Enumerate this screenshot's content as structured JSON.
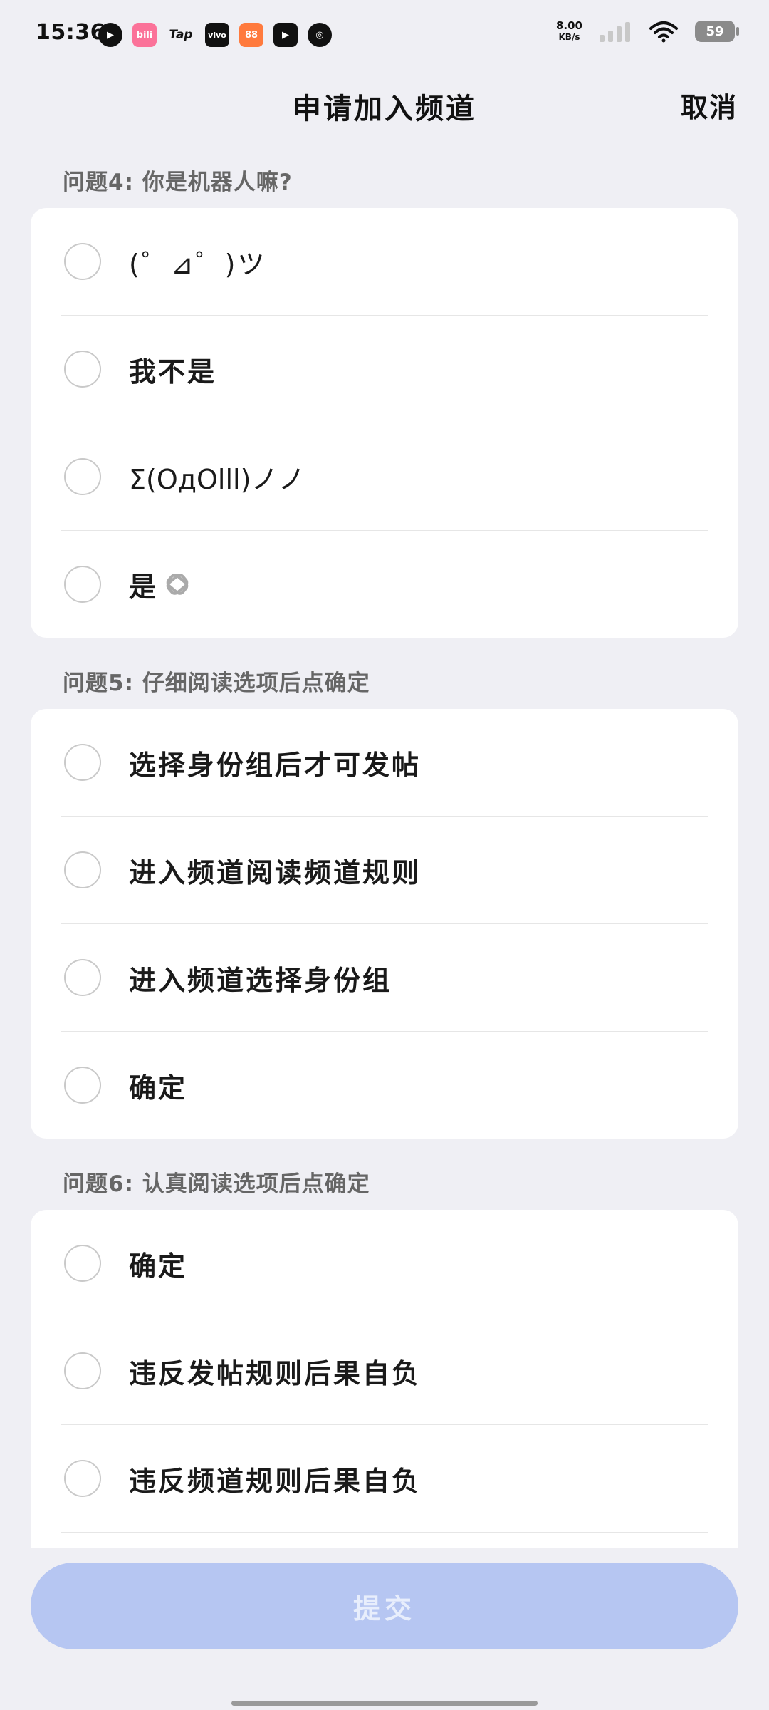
{
  "status_bar": {
    "time": "15:36",
    "net_speed_value": "8.00",
    "net_speed_unit": "KB/s",
    "battery": "59",
    "app_icons": [
      {
        "name": "play-icon",
        "glyph": "▶",
        "bg": "#111111"
      },
      {
        "name": "bilibili-icon",
        "glyph": "bili",
        "bg": "#fb7299"
      },
      {
        "name": "tap-icon",
        "glyph": "Tap",
        "bg": "transparent"
      },
      {
        "name": "vivo-icon",
        "glyph": "vivo",
        "bg": "#111111"
      },
      {
        "name": "store-icon",
        "glyph": "88",
        "bg": "#ff7a3d"
      },
      {
        "name": "video-icon",
        "glyph": "▶",
        "bg": "#111111"
      },
      {
        "name": "leaf-icon",
        "glyph": "◎",
        "bg": "#111111"
      }
    ]
  },
  "header": {
    "title": "申请加入频道",
    "cancel_label": "取消"
  },
  "questions": [
    {
      "label": "问题4: 你是机器人嘛?",
      "options": [
        "(゜⊿゜)ツ",
        "我不是",
        "Σ(OдOlll)ノノ",
        "是"
      ]
    },
    {
      "label": "问题5: 仔细阅读选项后点确定",
      "options": [
        "选择身份组后才可发帖",
        "进入频道阅读频道规则",
        "进入频道选择身份组",
        "确定"
      ]
    },
    {
      "label": "问题6: 认真阅读选项后点确定",
      "options": [
        "确定",
        "违反发帖规则后果自负",
        "违反频道规则后果自负",
        ""
      ]
    }
  ],
  "submit_label": "提交",
  "colors": {
    "background": "#efeff4",
    "submit_bg": "#b6c6f2",
    "submit_text": "#e8eefc"
  }
}
